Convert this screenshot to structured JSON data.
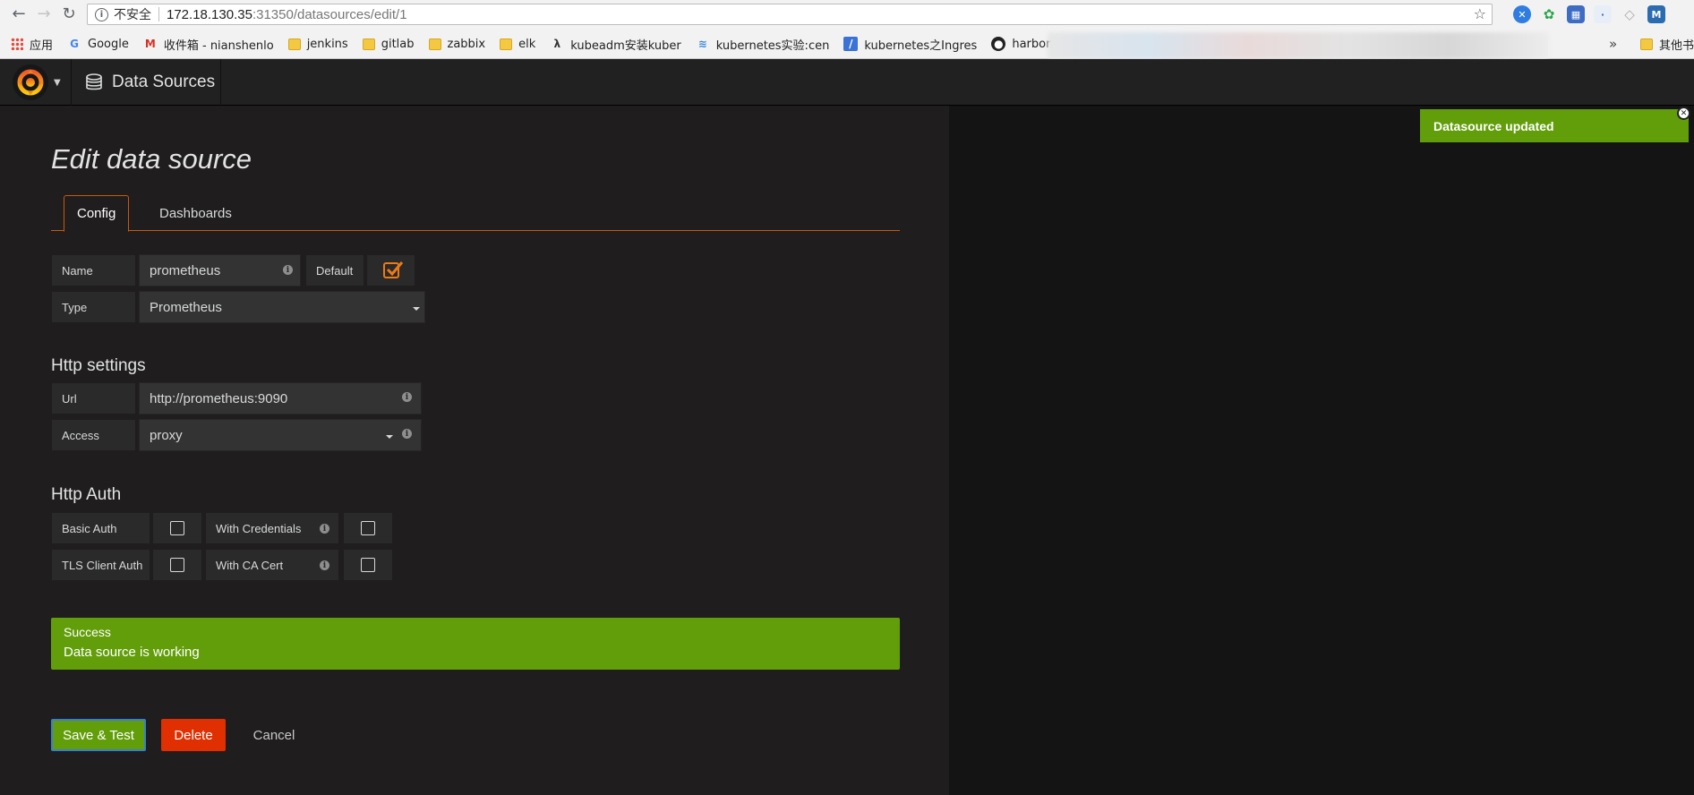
{
  "browser": {
    "address": {
      "security_label": "不安全",
      "host": "172.18.130.35",
      "rest": ":31350/datasources/edit/1"
    },
    "bookmarks": [
      {
        "label": "应用",
        "icon": "apps-icon"
      },
      {
        "label": "Google",
        "icon": "google-icon"
      },
      {
        "label": "收件箱 - nianshenlo",
        "icon": "gmail-icon"
      },
      {
        "label": "jenkins",
        "icon": "folder-icon"
      },
      {
        "label": "gitlab",
        "icon": "folder-icon"
      },
      {
        "label": "zabbix",
        "icon": "folder-icon"
      },
      {
        "label": "elk",
        "icon": "folder-icon"
      },
      {
        "label": "kubeadm安装kuber",
        "icon": "lambda-icon"
      },
      {
        "label": "kubernetes实验:cen",
        "icon": "chevron-icon"
      },
      {
        "label": "kubernetes之Ingres",
        "icon": "pen-icon"
      },
      {
        "label": "harbor/installation_",
        "icon": "github-icon"
      }
    ],
    "more_label": "»",
    "other_bookmarks_label": "其他书签"
  },
  "navbar": {
    "section_title": "Data Sources"
  },
  "page": {
    "title": "Edit data source",
    "tabs": [
      {
        "label": "Config"
      },
      {
        "label": "Dashboards"
      }
    ]
  },
  "form": {
    "name_label": "Name",
    "name_value": "prometheus",
    "default_label": "Default",
    "default_checked": true,
    "type_label": "Type",
    "type_value": "Prometheus",
    "http_settings_title": "Http settings",
    "url_label": "Url",
    "url_value": "http://prometheus:9090",
    "access_label": "Access",
    "access_value": "proxy",
    "http_auth_title": "Http Auth",
    "basic_auth_label": "Basic Auth",
    "with_credentials_label": "With Credentials",
    "tls_client_auth_label": "TLS Client Auth",
    "with_ca_cert_label": "With CA Cert"
  },
  "alert": {
    "title": "Success",
    "message": "Data source is working"
  },
  "actions": {
    "save_label": "Save & Test",
    "delete_label": "Delete",
    "cancel_label": "Cancel"
  },
  "toast": {
    "message": "Datasource updated"
  },
  "colors": {
    "accent": "#eb7b18",
    "success": "#629e0a",
    "danger": "#e02f00",
    "focus": "#3a7fcf"
  }
}
